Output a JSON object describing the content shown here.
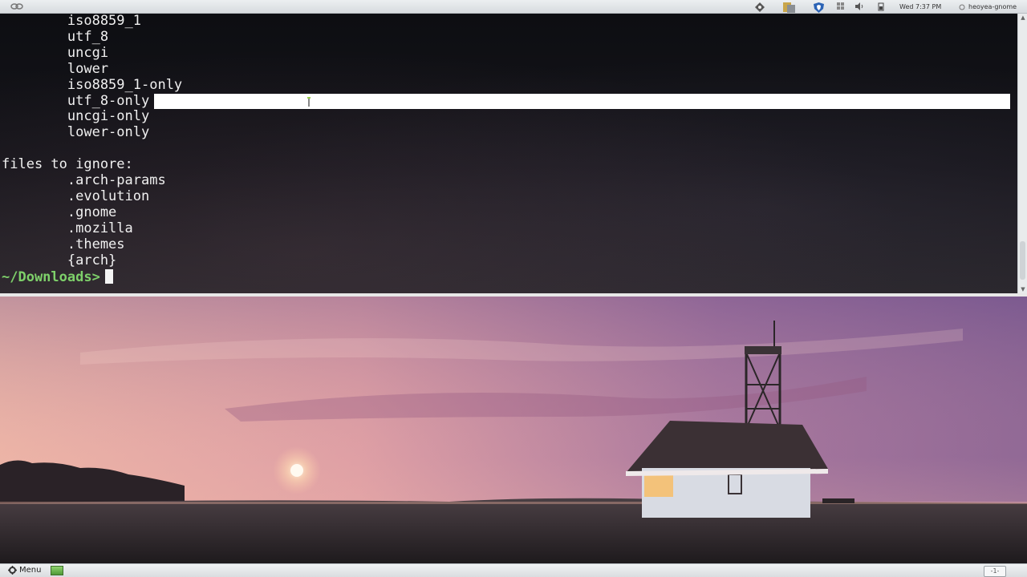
{
  "top_panel": {
    "clock": "Wed  7:37 PM",
    "user": "heoyea-gnome",
    "icons": [
      "link-icon",
      "network-icon",
      "files-icon",
      "shield-icon",
      "window-list-icon",
      "volume-icon",
      "battery-icon",
      "user-icon"
    ]
  },
  "terminal": {
    "lines": [
      "        iso8859_1",
      "        utf_8",
      "        uncgi",
      "        lower",
      "        iso8859_1-only",
      "        utf_8-only",
      "        uncgi-only",
      "        lower-only",
      "",
      "files to ignore:",
      "        .arch-params",
      "        .evolution",
      "        .gnome",
      "        .mozilla",
      "        .themes",
      "        {arch}"
    ],
    "prompt": "~/Downloads>"
  },
  "bottom_panel": {
    "menu_label": "Menu",
    "workspace": "-1-"
  },
  "colors": {
    "prompt": "#7ed06a",
    "terminal_text": "#f0f0f0",
    "panel": "#e2e5e8"
  }
}
